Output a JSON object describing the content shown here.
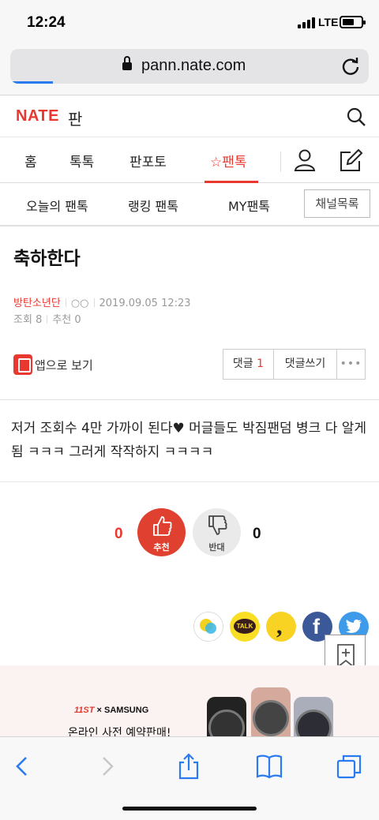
{
  "status_bar": {
    "time": "12:24",
    "network": "LTE"
  },
  "browser": {
    "url": "pann.nate.com"
  },
  "header": {
    "logo": "NATE",
    "section": "판"
  },
  "main_nav": [
    "홈",
    "톡톡",
    "판포토",
    "팬톡"
  ],
  "sub_nav": [
    "오늘의 팬톡",
    "랭킹 팬톡",
    "MY팬톡"
  ],
  "channel_button": "채널목록",
  "post": {
    "title": "축하한다",
    "author": "방탄소년단",
    "author_extra": "○○",
    "datetime": "2019.09.05 12:23",
    "views_label": "조회",
    "views": "8",
    "recommend_label": "추천",
    "recommend": "0",
    "app_view": "앱으로 보기",
    "comment_label": "댓글",
    "comment_count": "1",
    "write_comment": "댓글쓰기",
    "more": "•••",
    "body": "저거 조회수 4만 가까이 된다♥ 머글들도 박짐팬덤 병크 다 알게 됨 ㅋㅋㅋ 그러게 작작하지 ㅋㅋㅋㅋ"
  },
  "votes": {
    "up_count": "0",
    "up_label": "추천",
    "down_label": "반대",
    "down_count": "0"
  },
  "share": {
    "kakaotalk": "TALK",
    "kakaostory": ",",
    "facebook": "f"
  },
  "ad": {
    "brand_11": "11ST",
    "brand_samsung": "× SAMSUNG",
    "text": "온라인 사전 예약판매!"
  },
  "colors": {
    "accent": "#e8382f",
    "safari_blue": "#2b7bf0"
  }
}
